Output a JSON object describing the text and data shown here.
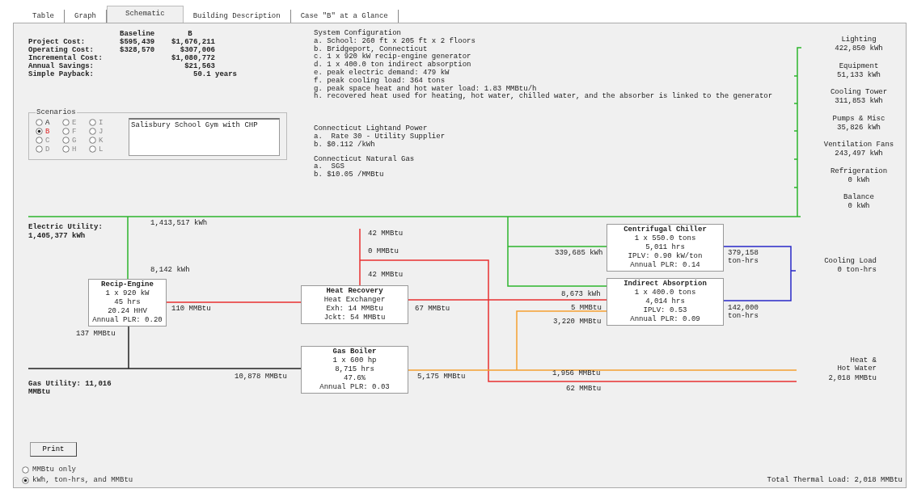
{
  "tabs": [
    {
      "label": "Table",
      "selected": false
    },
    {
      "label": "Graph",
      "selected": false
    },
    {
      "label": "Schematic",
      "selected": true
    },
    {
      "label": "Building Description",
      "selected": false
    },
    {
      "label": "Case \"B\" at a Glance",
      "selected": false
    }
  ],
  "costs": {
    "headers": [
      "Baseline",
      "B"
    ],
    "rows": [
      {
        "kind": "pair",
        "label": "Project Cost:",
        "baseline": "$595,439",
        "case": "$1,676,211"
      },
      {
        "kind": "pair",
        "label": "Operating Cost:",
        "baseline": "$328,570",
        "case": "$307,006"
      },
      {
        "kind": "single",
        "label": "Incremental Cost:",
        "case": "$1,080,772"
      },
      {
        "kind": "single",
        "label": "Annual Savings:",
        "case": "$21,563"
      },
      {
        "kind": "wide",
        "label": "Simple Payback:",
        "case": "50.1 years"
      }
    ]
  },
  "scenarios": {
    "title": "Scenarios",
    "options": [
      {
        "label": "A",
        "selected": false,
        "disabled": false
      },
      {
        "label": "B",
        "selected": true,
        "disabled": false
      },
      {
        "label": "C",
        "selected": false,
        "disabled": true
      },
      {
        "label": "D",
        "selected": false,
        "disabled": true
      },
      {
        "label": "E",
        "selected": false,
        "disabled": true
      },
      {
        "label": "F",
        "selected": false,
        "disabled": true
      },
      {
        "label": "G",
        "selected": false,
        "disabled": true
      },
      {
        "label": "H",
        "selected": false,
        "disabled": true
      },
      {
        "label": "I",
        "selected": false,
        "disabled": true
      },
      {
        "label": "J",
        "selected": false,
        "disabled": true
      },
      {
        "label": "K",
        "selected": false,
        "disabled": true
      },
      {
        "label": "L",
        "selected": false,
        "disabled": true
      }
    ],
    "description": "Salisbury School Gym with CHP"
  },
  "system_configuration": {
    "title": "System Configuration",
    "lines": [
      "a. School: 260 ft x 205 ft x 2 floors",
      "b. Bridgeport, Connecticut",
      "c. 1 x 920 kW recip-engine generator",
      "d. 1 x 400.0 ton indirect absorption",
      "e. peak electric demand: 479 kW",
      "f. peak cooling load: 364 tons",
      "g. peak space heat and hot water load: 1.83 MMBtu/h",
      "h. recovered heat used for heating, hot water, chilled water, and the absorber is linked to the generator"
    ]
  },
  "electric_supplier": {
    "title": "Connecticut Lightand Power",
    "lines": [
      "a.  Rate 30 - Utility Supplier",
      "b. $0.112 /kWh"
    ]
  },
  "gas_supplier": {
    "title": "Connecticut Natural Gas",
    "lines": [
      "a.  SGS",
      "b. $10.05 /MMBtu"
    ]
  },
  "end_uses": [
    {
      "name": "Lighting",
      "value": "422,850 kWh"
    },
    {
      "name": "Equipment",
      "value": "51,133 kWh"
    },
    {
      "name": "Cooling Tower",
      "value": "311,853 kWh"
    },
    {
      "name": "Pumps & Misc",
      "value": "35,826 kWh"
    },
    {
      "name": "Ventilation Fans",
      "value": "243,497 kWh"
    },
    {
      "name": "Refrigeration",
      "value": "0 kWh"
    },
    {
      "name": "Balance",
      "value": "0 kWh"
    }
  ],
  "electric_utility": {
    "label": "Electric Utility:",
    "value": "1,405,377 kWh"
  },
  "gas_utility": {
    "label": "Gas Utility: 11,016 MMBtu"
  },
  "equipment": [
    {
      "title": "Recip-Engine",
      "lines": [
        "1 x 920 kW",
        "45 hrs",
        "20.24 HHV",
        "Annual PLR: 0.20"
      ]
    },
    {
      "title": "Heat Recovery",
      "lines": [
        "Heat Exchanger",
        "Exh: 14 MMBtu",
        "Jckt:  54 MMBtu"
      ]
    },
    {
      "title": "Gas Boiler",
      "lines": [
        "1 x 600 hp",
        "8,715 hrs",
        "47.6%",
        "Annual PLR: 0.03"
      ]
    },
    {
      "title": "Centrifugal Chiller",
      "lines": [
        "1 x 550.0 tons",
        "5,011 hrs",
        "IPLV: 0.90 kW/ton",
        "Annual PLR: 0.14"
      ]
    },
    {
      "title": "Indirect Absorption",
      "lines": [
        "1 x 400.0 tons",
        "4,014 hrs",
        "IPLV: 0.53",
        "Annual PLR: 0.09"
      ]
    }
  ],
  "flows": [
    "1,413,517 kWh",
    "8,142 kWh",
    "110 MMBtu",
    "137 MMBtu",
    "42 MMBtu",
    "0 MMBtu",
    "42 MMBtu",
    "67 MMBtu",
    "10,878 MMBtu",
    "5,175 MMBtu",
    "339,685 kWh",
    "8,673 kWh",
    "5 MMBtu",
    "3,220 MMBtu",
    "1,956 MMBtu",
    "62 MMBtu",
    "379,158 ton-hrs",
    "142,000 ton-hrs"
  ],
  "cooling_load": {
    "name": "Cooling Load",
    "value": "0 ton-hrs"
  },
  "heat_hot_water": {
    "name": "Heat & Hot Water",
    "value": "2,018 MMBtu"
  },
  "print_button": "Print",
  "units": [
    {
      "label": "MMBtu only",
      "selected": false
    },
    {
      "label": "kWh, ton-hrs, and MMBtu",
      "selected": true
    }
  ],
  "total_thermal_load": "Total Thermal Load: 2,018 MMBtu"
}
